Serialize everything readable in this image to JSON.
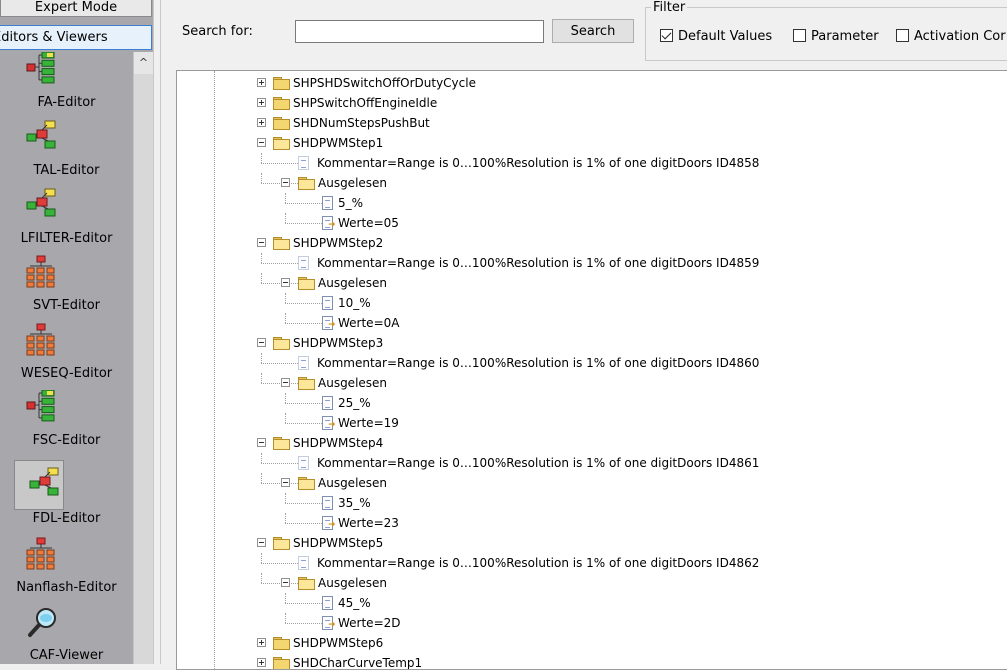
{
  "sidebar": {
    "expert_mode": "Expert Mode",
    "editors_tab": "Editors & Viewers",
    "items": [
      {
        "label": "FA-Editor",
        "icon": "hierarchy-icon"
      },
      {
        "label": "TAL-Editor",
        "icon": "tree-diagram-icon"
      },
      {
        "label": "LFILTER-Editor",
        "icon": "tree-diagram-icon"
      },
      {
        "label": "SVT-Editor",
        "icon": "org-chart-icon"
      },
      {
        "label": "WESEQ-Editor",
        "icon": "org-chart-icon"
      },
      {
        "label": "FSC-Editor",
        "icon": "hierarchy-icon"
      },
      {
        "label": "FDL-Editor",
        "icon": "tree-diagram-icon",
        "selected": true
      },
      {
        "label": "Nanflash-Editor",
        "icon": "org-chart-icon"
      },
      {
        "label": "CAF-Viewer",
        "icon": "magnifier-icon"
      }
    ]
  },
  "search": {
    "label": "Search for:",
    "value": "",
    "button": "Search"
  },
  "filter": {
    "legend": "Filter",
    "options": [
      {
        "label": "Default Values",
        "checked": true
      },
      {
        "label": "Parameter",
        "checked": false
      },
      {
        "label": "Activation Cor",
        "checked": false
      }
    ]
  },
  "tree": [
    {
      "level": 0,
      "type": "folder",
      "expander": "plus",
      "text": "SHPSHDSwitchOffOrDutyCycle"
    },
    {
      "level": 0,
      "type": "folder",
      "expander": "plus",
      "text": "SHPSwitchOffEngineIdle"
    },
    {
      "level": 0,
      "type": "folder",
      "expander": "plus",
      "text": "SHDNumStepsPushBut"
    },
    {
      "level": 0,
      "type": "folder-open",
      "expander": "minus",
      "text": "SHDPWMStep1"
    },
    {
      "level": 1,
      "type": "doc-faded",
      "text": "Kommentar=Range is 0…100%Resolution is 1% of one digitDoors ID4858"
    },
    {
      "level": 1,
      "type": "folder-open",
      "expander": "minus",
      "text": "Ausgelesen"
    },
    {
      "level": 2,
      "type": "doc",
      "text": "5_%"
    },
    {
      "level": 2,
      "type": "doc-arrow",
      "text": "Werte=05"
    },
    {
      "level": 0,
      "type": "folder-open",
      "expander": "minus",
      "text": "SHDPWMStep2"
    },
    {
      "level": 1,
      "type": "doc-faded",
      "text": "Kommentar=Range is 0…100%Resolution is 1% of one digitDoors ID4859"
    },
    {
      "level": 1,
      "type": "folder-open",
      "expander": "minus",
      "text": "Ausgelesen"
    },
    {
      "level": 2,
      "type": "doc",
      "text": "10_%"
    },
    {
      "level": 2,
      "type": "doc-arrow",
      "text": "Werte=0A"
    },
    {
      "level": 0,
      "type": "folder-open",
      "expander": "minus",
      "text": "SHDPWMStep3"
    },
    {
      "level": 1,
      "type": "doc-faded",
      "text": "Kommentar=Range is 0…100%Resolution is 1% of one digitDoors ID4860"
    },
    {
      "level": 1,
      "type": "folder-open",
      "expander": "minus",
      "text": "Ausgelesen"
    },
    {
      "level": 2,
      "type": "doc",
      "text": "25_%"
    },
    {
      "level": 2,
      "type": "doc-arrow",
      "text": "Werte=19"
    },
    {
      "level": 0,
      "type": "folder-open",
      "expander": "minus",
      "text": "SHDPWMStep4"
    },
    {
      "level": 1,
      "type": "doc-faded",
      "text": "Kommentar=Range is 0…100%Resolution is 1% of one digitDoors ID4861"
    },
    {
      "level": 1,
      "type": "folder-open",
      "expander": "minus",
      "text": "Ausgelesen"
    },
    {
      "level": 2,
      "type": "doc",
      "text": "35_%"
    },
    {
      "level": 2,
      "type": "doc-arrow",
      "text": "Werte=23"
    },
    {
      "level": 0,
      "type": "folder-open",
      "expander": "minus",
      "text": "SHDPWMStep5"
    },
    {
      "level": 1,
      "type": "doc-faded",
      "text": "Kommentar=Range is 0…100%Resolution is 1% of one digitDoors ID4862"
    },
    {
      "level": 1,
      "type": "folder-open",
      "expander": "minus",
      "text": "Ausgelesen"
    },
    {
      "level": 2,
      "type": "doc",
      "text": "45_%"
    },
    {
      "level": 2,
      "type": "doc-arrow",
      "text": "Werte=2D"
    },
    {
      "level": 0,
      "type": "folder",
      "expander": "plus",
      "text": "SHDPWMStep6"
    },
    {
      "level": 0,
      "type": "folder",
      "expander": "plus",
      "text": "SHDCharCurveTemp1"
    }
  ],
  "scroll_up_glyph": "^"
}
